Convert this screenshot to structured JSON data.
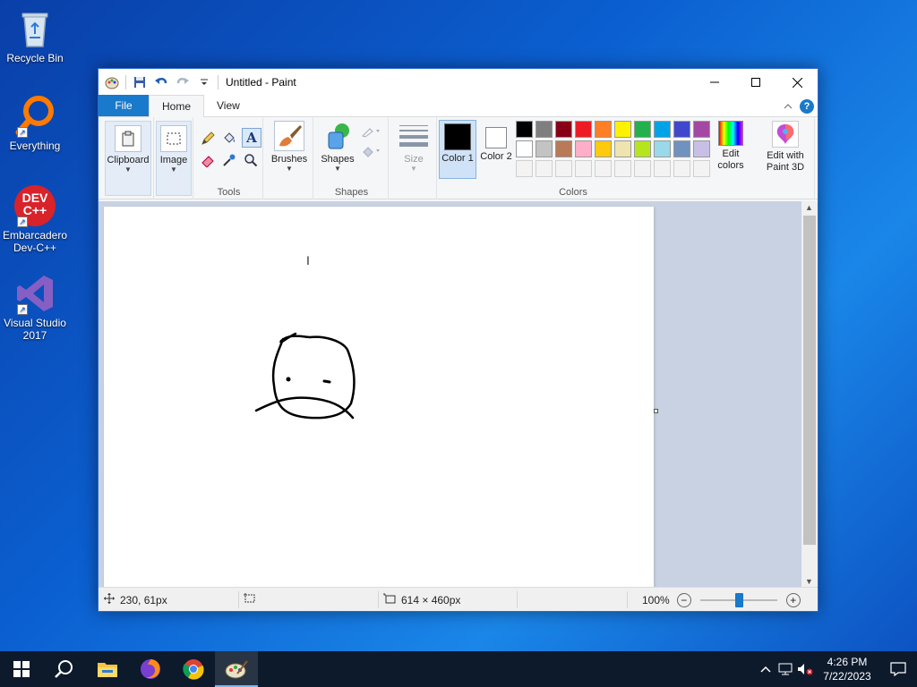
{
  "desktop": {
    "icons": [
      {
        "label": "Recycle Bin"
      },
      {
        "label": "Everything"
      },
      {
        "label": "Embarcadero Dev-C++",
        "logo_text": "DEV C++"
      },
      {
        "label": "Visual Studio 2017"
      }
    ]
  },
  "window": {
    "title": "Untitled - Paint",
    "tabs": {
      "file": "File",
      "home": "Home",
      "view": "View"
    },
    "ribbon": {
      "clipboard": "Clipboard",
      "image": "Image",
      "tools_label": "Tools",
      "brushes": "Brushes",
      "shapes": "Shapes",
      "shapes_label": "Shapes",
      "size": "Size",
      "color1": "Color 1",
      "color2": "Color 2",
      "colors_label": "Colors",
      "edit_colors": "Edit colors",
      "edit_paint3d": "Edit with Paint 3D",
      "help": "?",
      "color1_value": "#000000",
      "color2_value": "#ffffff",
      "palette_row1": [
        "#000000",
        "#7f7f7f",
        "#880015",
        "#ed1c24",
        "#ff7f27",
        "#fff200",
        "#22b14c",
        "#00a2e8",
        "#3f48cc",
        "#a349a4"
      ],
      "palette_row2": [
        "#ffffff",
        "#c3c3c3",
        "#b97a57",
        "#ffaec9",
        "#ffc90e",
        "#efe4b0",
        "#b5e61d",
        "#99d9ea",
        "#7092be",
        "#c8bfe7"
      ]
    },
    "status": {
      "cursor_pos": "230, 61px",
      "canvas_size": "614 × 460px",
      "zoom": "100%",
      "zoom_level": 0.5
    }
  },
  "taskbar": {
    "time": "4:26 PM",
    "date": "7/22/2023"
  }
}
